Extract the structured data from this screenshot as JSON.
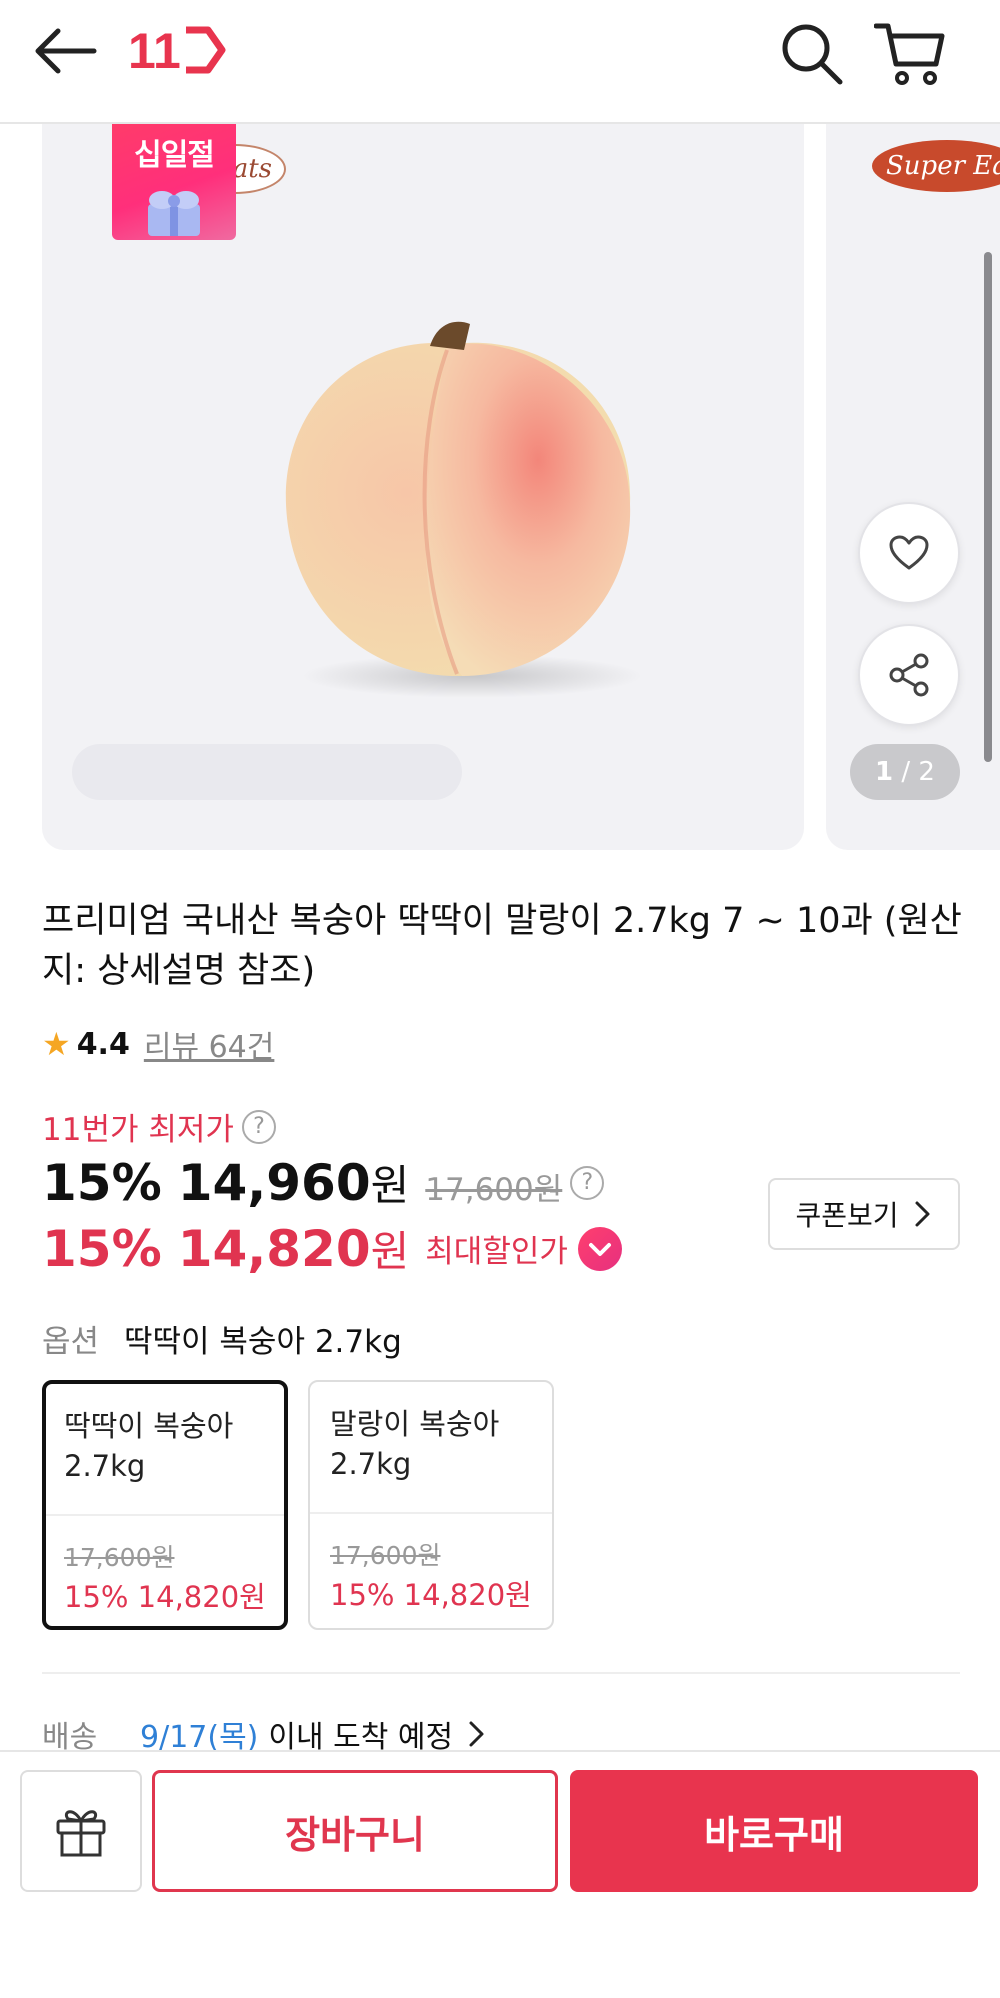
{
  "header": {
    "logo_text": "11",
    "icons": {
      "back": "back-arrow-icon",
      "search": "search-icon",
      "cart": "cart-icon"
    },
    "brand_color": "#e8344e"
  },
  "gallery": {
    "event_badge": "십일절",
    "brand_logo": "Super Eats",
    "brand_logo_partial": "ats",
    "brand_logo_next": "Super Eat",
    "page_current": "1",
    "page_sep": "/",
    "page_total": "2",
    "icons": {
      "wish": "heart-icon",
      "share": "share-icon"
    }
  },
  "product": {
    "title": "프리미엄 국내산 복숭아 딱딱이 말랑이 2.7kg 7 ~ 10과 (원산지: 상세설명 참조)",
    "rating": "4.4",
    "reviews": "리뷰 64건"
  },
  "price": {
    "lowest_label": "11번가 최저가",
    "help": "?",
    "discount_pct": "15%",
    "sale_amount": "14,960",
    "won": "원",
    "original": "17,600원",
    "max_discount_pct": "15%",
    "max_discount_amount": "14,820",
    "max_discount_label": "최대할인가",
    "coupon_button": "쿠폰보기"
  },
  "options": {
    "label": "옵션",
    "selected_value": "딱딱이 복숭아 2.7kg",
    "items": [
      {
        "name": "딱딱이 복숭아 2.7kg",
        "original": "17,600원",
        "sale": "15% 14,820원",
        "selected": true
      },
      {
        "name": "말랑이 복숭아 2.7kg",
        "original": "17,600원",
        "sale": "15% 14,820원",
        "selected": false
      }
    ]
  },
  "delivery": {
    "label": "배송",
    "date": "9/17(목)",
    "text": "이내 도착 예정"
  },
  "bottom": {
    "gift_icon": "gift-icon",
    "cart_button": "장바구니",
    "buy_button": "바로구매"
  }
}
